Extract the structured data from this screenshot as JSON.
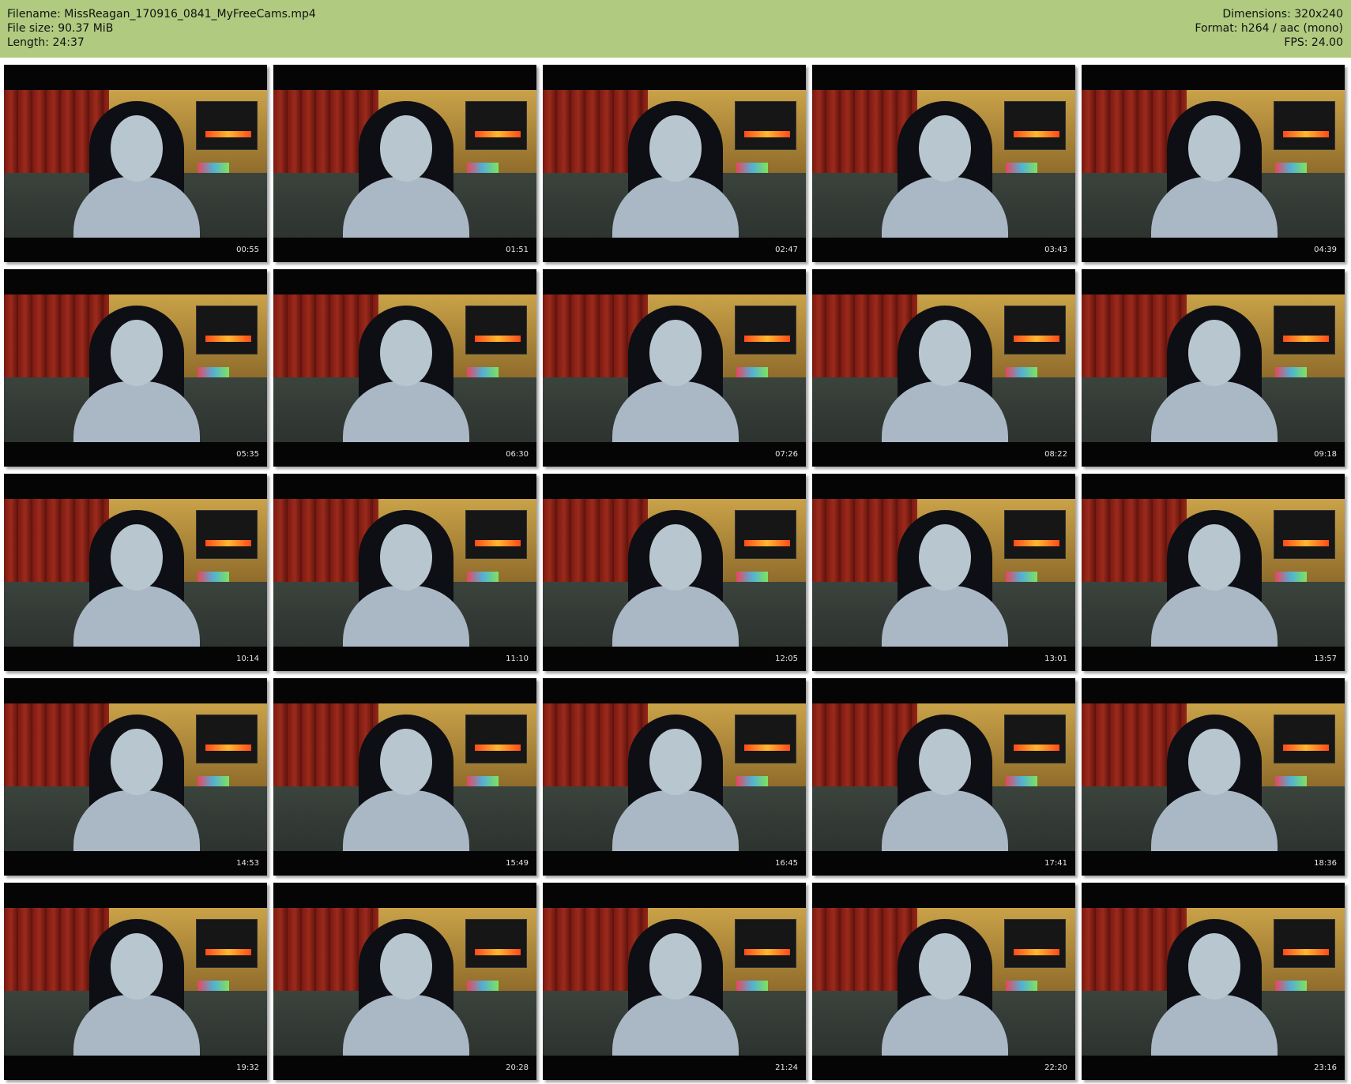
{
  "header": {
    "filename_line": "Filename: MissReagan_170916_0841_MyFreeCams.mp4",
    "filesize_line": "File size: 90.37 MiB",
    "length_line": "Length: 24:37",
    "dimensions_line": "Dimensions: 320x240",
    "format_line": "Format: h264 / aac (mono)",
    "fps_line": "FPS: 24.00",
    "background_color": "#b0cb80"
  },
  "thumbnails": [
    {
      "timestamp": "00:55"
    },
    {
      "timestamp": "01:51"
    },
    {
      "timestamp": "02:47"
    },
    {
      "timestamp": "03:43"
    },
    {
      "timestamp": "04:39"
    },
    {
      "timestamp": "05:35"
    },
    {
      "timestamp": "06:30"
    },
    {
      "timestamp": "07:26"
    },
    {
      "timestamp": "08:22"
    },
    {
      "timestamp": "09:18"
    },
    {
      "timestamp": "10:14"
    },
    {
      "timestamp": "11:10"
    },
    {
      "timestamp": "12:05"
    },
    {
      "timestamp": "13:01"
    },
    {
      "timestamp": "13:57"
    },
    {
      "timestamp": "14:53"
    },
    {
      "timestamp": "15:49"
    },
    {
      "timestamp": "16:45"
    },
    {
      "timestamp": "17:41"
    },
    {
      "timestamp": "18:36"
    },
    {
      "timestamp": "19:32"
    },
    {
      "timestamp": "20:28"
    },
    {
      "timestamp": "21:24"
    },
    {
      "timestamp": "22:20"
    },
    {
      "timestamp": "23:16"
    }
  ]
}
